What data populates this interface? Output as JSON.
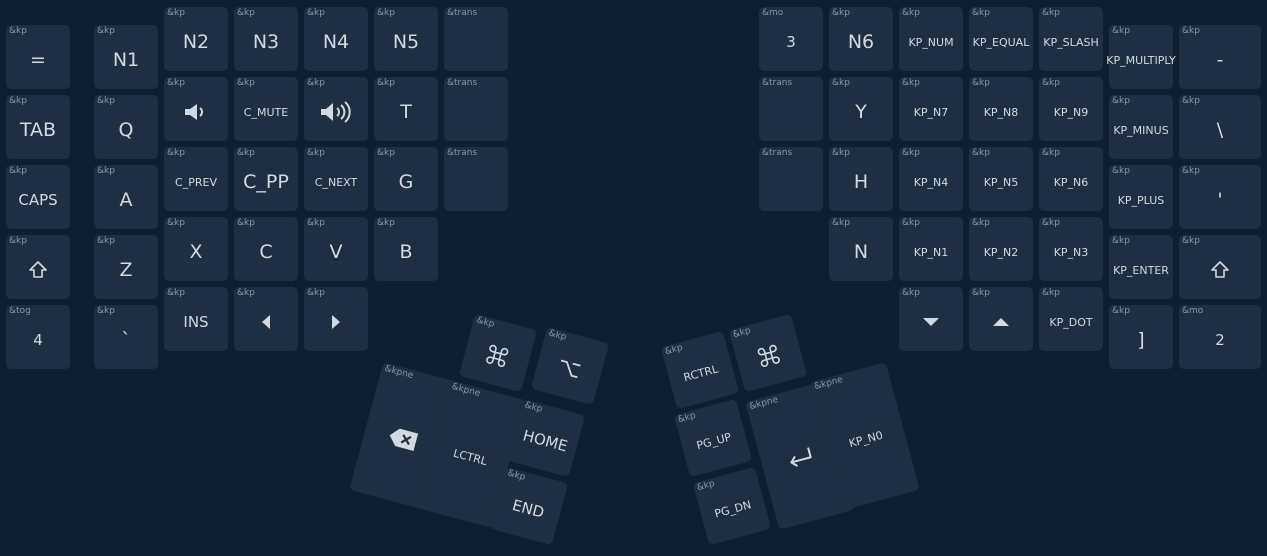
{
  "keys": [
    {
      "id": "l-eq",
      "tag": "&kp",
      "label": "="
    },
    {
      "id": "l-n1",
      "tag": "&kp",
      "label": "N1"
    },
    {
      "id": "l-n2",
      "tag": "&kp",
      "label": "N2"
    },
    {
      "id": "l-n3",
      "tag": "&kp",
      "label": "N3"
    },
    {
      "id": "l-n4",
      "tag": "&kp",
      "label": "N4"
    },
    {
      "id": "l-n5",
      "tag": "&kp",
      "label": "N5"
    },
    {
      "id": "l-tr1",
      "tag": "&trans",
      "label": ""
    },
    {
      "id": "l-tab",
      "tag": "&kp",
      "label": "TAB"
    },
    {
      "id": "l-q",
      "tag": "&kp",
      "label": "Q"
    },
    {
      "id": "l-vold",
      "tag": "&kp",
      "label": "",
      "icon": "volume-down-icon"
    },
    {
      "id": "l-mute",
      "tag": "&kp",
      "label": "C_MUTE",
      "size": "small"
    },
    {
      "id": "l-volu",
      "tag": "&kp",
      "label": "",
      "icon": "volume-up-icon"
    },
    {
      "id": "l-t",
      "tag": "&kp",
      "label": "T"
    },
    {
      "id": "l-tr2",
      "tag": "&trans",
      "label": ""
    },
    {
      "id": "l-caps",
      "tag": "&kp",
      "label": "CAPS",
      "size": "med"
    },
    {
      "id": "l-a",
      "tag": "&kp",
      "label": "A"
    },
    {
      "id": "l-prev",
      "tag": "&kp",
      "label": "C_PREV",
      "size": "small"
    },
    {
      "id": "l-pp",
      "tag": "&kp",
      "label": "C_PP"
    },
    {
      "id": "l-next",
      "tag": "&kp",
      "label": "C_NEXT",
      "size": "small"
    },
    {
      "id": "l-g",
      "tag": "&kp",
      "label": "G"
    },
    {
      "id": "l-tr3",
      "tag": "&trans",
      "label": ""
    },
    {
      "id": "l-shift",
      "tag": "&kp",
      "label": "",
      "icon": "shift-icon"
    },
    {
      "id": "l-z",
      "tag": "&kp",
      "label": "Z"
    },
    {
      "id": "l-x",
      "tag": "&kp",
      "label": "X"
    },
    {
      "id": "l-c",
      "tag": "&kp",
      "label": "C"
    },
    {
      "id": "l-v",
      "tag": "&kp",
      "label": "V"
    },
    {
      "id": "l-b",
      "tag": "&kp",
      "label": "B"
    },
    {
      "id": "l-tog4",
      "tag": "&tog",
      "label": "4",
      "size": "med"
    },
    {
      "id": "l-grave",
      "tag": "&kp",
      "label": "`"
    },
    {
      "id": "l-ins",
      "tag": "&kp",
      "label": "INS",
      "size": "med"
    },
    {
      "id": "l-left",
      "tag": "&kp",
      "label": "",
      "icon": "arrow-left-icon"
    },
    {
      "id": "l-right",
      "tag": "&kp",
      "label": "",
      "icon": "arrow-right-icon"
    },
    {
      "id": "l-cmd",
      "tag": "&kp",
      "label": "",
      "icon": "command-icon"
    },
    {
      "id": "l-opt",
      "tag": "&kp",
      "label": "",
      "icon": "option-icon"
    },
    {
      "id": "l-bksp",
      "tag": "&kpne",
      "label": "",
      "icon": "backspace-icon"
    },
    {
      "id": "l-lctrl",
      "tag": "&kpne",
      "label": "LCTRL",
      "size": "small"
    },
    {
      "id": "l-home",
      "tag": "&kp",
      "label": "HOME",
      "size": "med"
    },
    {
      "id": "l-end",
      "tag": "&kp",
      "label": "END",
      "size": "med"
    },
    {
      "id": "r-mo3",
      "tag": "&mo",
      "label": "3",
      "size": "med"
    },
    {
      "id": "r-n6",
      "tag": "&kp",
      "label": "N6"
    },
    {
      "id": "r-num",
      "tag": "&kp",
      "label": "KP_NUM",
      "size": "small"
    },
    {
      "id": "r-equal",
      "tag": "&kp",
      "label": "KP_EQUAL",
      "size": "small"
    },
    {
      "id": "r-slash",
      "tag": "&kp",
      "label": "KP_SLASH",
      "size": "small"
    },
    {
      "id": "r-mult",
      "tag": "&kp",
      "label": "KP_MULTIPLY",
      "size": "small"
    },
    {
      "id": "r-minus",
      "tag": "&kp",
      "label": "-"
    },
    {
      "id": "r-tr1",
      "tag": "&trans",
      "label": ""
    },
    {
      "id": "r-y",
      "tag": "&kp",
      "label": "Y"
    },
    {
      "id": "r-n7",
      "tag": "&kp",
      "label": "KP_N7",
      "size": "small"
    },
    {
      "id": "r-n8",
      "tag": "&kp",
      "label": "KP_N8",
      "size": "small"
    },
    {
      "id": "r-n9",
      "tag": "&kp",
      "label": "KP_N9",
      "size": "small"
    },
    {
      "id": "r-kpmin",
      "tag": "&kp",
      "label": "KP_MINUS",
      "size": "small"
    },
    {
      "id": "r-bslash",
      "tag": "&kp",
      "label": "\\"
    },
    {
      "id": "r-tr2",
      "tag": "&trans",
      "label": ""
    },
    {
      "id": "r-h",
      "tag": "&kp",
      "label": "H"
    },
    {
      "id": "r-n4",
      "tag": "&kp",
      "label": "KP_N4",
      "size": "small"
    },
    {
      "id": "r-n5",
      "tag": "&kp",
      "label": "KP_N5",
      "size": "small"
    },
    {
      "id": "r-n6k",
      "tag": "&kp",
      "label": "KP_N6",
      "size": "small"
    },
    {
      "id": "r-plus",
      "tag": "&kp",
      "label": "KP_PLUS",
      "size": "small"
    },
    {
      "id": "r-apos",
      "tag": "&kp",
      "label": "'"
    },
    {
      "id": "r-n",
      "tag": "&kp",
      "label": "N"
    },
    {
      "id": "r-n1",
      "tag": "&kp",
      "label": "KP_N1",
      "size": "small"
    },
    {
      "id": "r-n2",
      "tag": "&kp",
      "label": "KP_N2",
      "size": "small"
    },
    {
      "id": "r-n3",
      "tag": "&kp",
      "label": "KP_N3",
      "size": "small"
    },
    {
      "id": "r-enter",
      "tag": "&kp",
      "label": "KP_ENTER",
      "size": "small"
    },
    {
      "id": "r-shift",
      "tag": "&kp",
      "label": "",
      "icon": "shift-icon"
    },
    {
      "id": "r-down",
      "tag": "&kp",
      "label": "",
      "icon": "arrow-down-icon"
    },
    {
      "id": "r-up",
      "tag": "&kp",
      "label": "",
      "icon": "arrow-up-icon"
    },
    {
      "id": "r-dot",
      "tag": "&kp",
      "label": "KP_DOT",
      "size": "small"
    },
    {
      "id": "r-rbrk",
      "tag": "&kp",
      "label": "]"
    },
    {
      "id": "r-mo2",
      "tag": "&mo",
      "label": "2",
      "size": "med"
    },
    {
      "id": "r-rctrl",
      "tag": "&kp",
      "label": "RCTRL",
      "size": "small"
    },
    {
      "id": "r-cmd",
      "tag": "&kp",
      "label": "",
      "icon": "command-icon"
    },
    {
      "id": "r-pgup",
      "tag": "&kp",
      "label": "PG_UP",
      "size": "small"
    },
    {
      "id": "r-enter2",
      "tag": "&kpne",
      "label": "",
      "icon": "return-icon"
    },
    {
      "id": "r-kpn0",
      "tag": "&kpne",
      "label": "KP_N0",
      "size": "small"
    },
    {
      "id": "r-pgdn",
      "tag": "&kp",
      "label": "PG_DN",
      "size": "small"
    }
  ]
}
